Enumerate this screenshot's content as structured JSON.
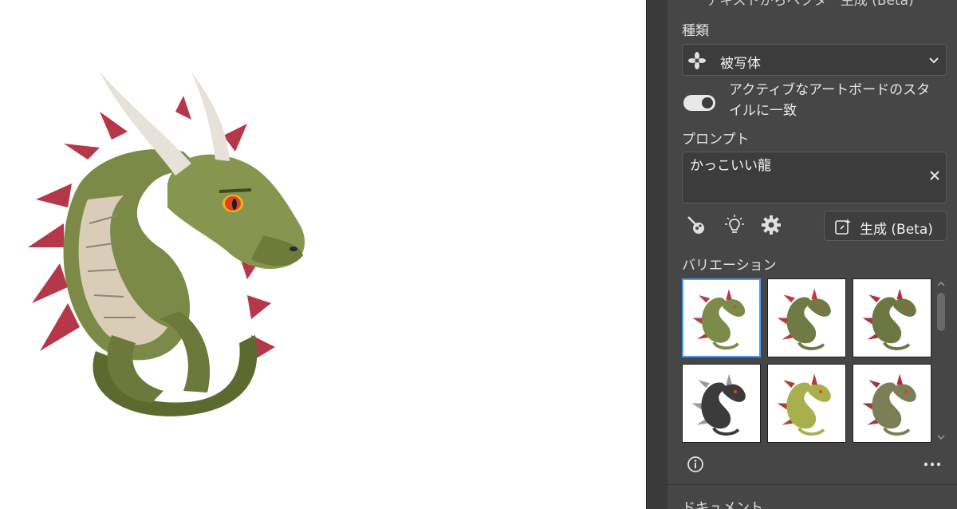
{
  "panel": {
    "title_partial": "テキストからベクター生成 (Beta)",
    "type_section": {
      "label": "種類",
      "selected": "被写体",
      "icon": "flower-icon"
    },
    "style_match": {
      "label": "アクティブなアートボードのスタイルに一致",
      "enabled": true
    },
    "prompt_section": {
      "label": "プロンプト",
      "value": "かっこいい龍"
    },
    "tools": [
      "style-picker-icon",
      "lightbulb-icon",
      "gear-icon"
    ],
    "generate_button": {
      "label": "生成 (Beta)",
      "icon": "generate-spark-icon"
    },
    "variations": {
      "label": "バリエーション",
      "items": [
        {
          "name": "variation-1",
          "body_color": "#7c8a4a",
          "accent": "#b83a4a",
          "selected": true
        },
        {
          "name": "variation-2",
          "body_color": "#6f7a44",
          "accent": "#c0393c",
          "selected": false
        },
        {
          "name": "variation-3",
          "body_color": "#6b7842",
          "accent": "#a8343c",
          "selected": false
        },
        {
          "name": "variation-4",
          "body_color": "#3b3b3b",
          "accent": "#9a9a9a",
          "selected": false
        },
        {
          "name": "variation-5",
          "body_color": "#a8b04e",
          "accent": "#b0402c",
          "selected": false
        },
        {
          "name": "variation-6",
          "body_color": "#7b7f55",
          "accent": "#a53440",
          "selected": false
        }
      ]
    },
    "footer_icons": [
      "info-icon",
      "more-icon"
    ],
    "next_section_label": "ドキュメント"
  },
  "colors": {
    "panel_bg": "#464646",
    "accent_selection": "#4b9cf5",
    "dragon_green": "#7b8a47",
    "dragon_red": "#b7374a",
    "dragon_horn": "#e6e2da"
  }
}
